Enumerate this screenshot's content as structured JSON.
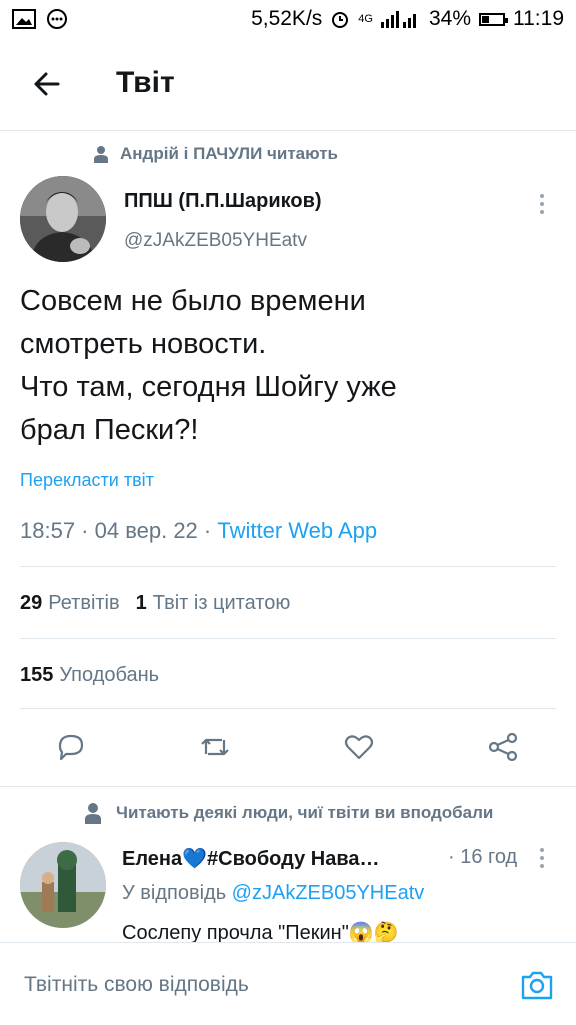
{
  "statusbar": {
    "speed": "5,52K/s",
    "network": "4G",
    "battery_pct": "34%",
    "battery_level": 0.34,
    "time": "11:19"
  },
  "header": {
    "title": "Твіт"
  },
  "social_context": "Андрій і ПАЧУЛИ читають",
  "tweet": {
    "name": "ППШ (П.П.Шариков)",
    "handle": "@zJAkZEB05YHEatv",
    "text": "Совсем не было времени\nсмотреть новости.\nЧто там, сегодня Шойгу уже\nбрал Пески?!",
    "translate": "Перекласти твіт",
    "time": "18:57 · 04 вер. 22 · ",
    "source": "Twitter Web App",
    "retweets_count": "29",
    "retweets_label": "Ретвітів",
    "quotes_count": "1",
    "quotes_label": "Твіт із цитатою",
    "likes_count": "155",
    "likes_label": "Уподобань"
  },
  "reply": {
    "social_context": "Читають деякі люди, чиї твіти ви вподобали",
    "name": "Елена💙#Свободу Нава…",
    "time": "· 16 год",
    "in_reply_prefix": "У відповідь ",
    "in_reply_handle": "@zJAkZEB05YHEatv",
    "text": "Сослепу прочла \"Пекин\"😱🤔"
  },
  "composer": {
    "placeholder": "Твітніть свою відповідь"
  },
  "colors": {
    "accent": "#1da1f2",
    "muted": "#657786",
    "text": "#14171a",
    "divider": "#e1e8ed"
  }
}
